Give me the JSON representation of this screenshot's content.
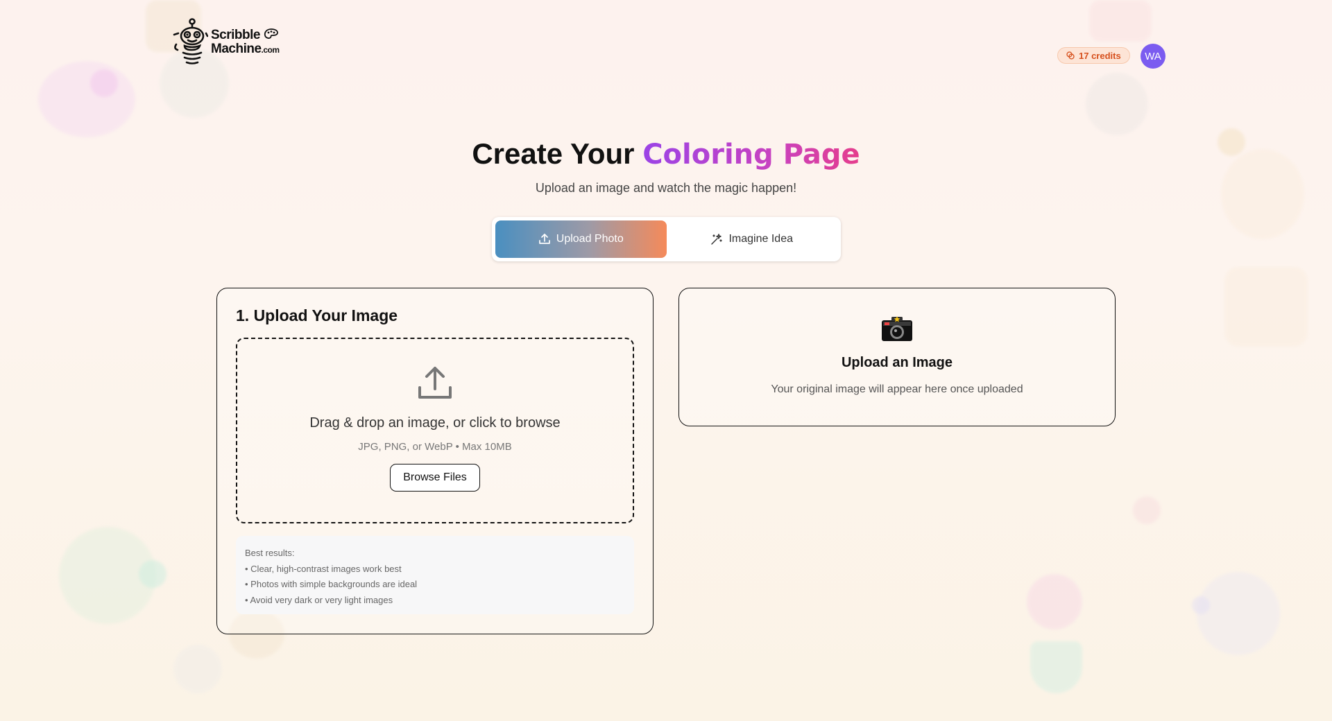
{
  "header": {
    "logo_name": "Scribble",
    "logo_name2": "Machine",
    "logo_domain": ".com",
    "credits": "17 credits",
    "avatar_initials": "WA"
  },
  "hero": {
    "title_prefix": "Create Your",
    "title_accent": "Coloring Page",
    "subtitle": "Upload an image and watch the magic happen!"
  },
  "mode_switch": {
    "tabs": [
      {
        "label": "Upload Photo",
        "icon": "upload-icon",
        "active": true
      },
      {
        "label": "Imagine Idea",
        "icon": "sparkles-icon",
        "active": false
      }
    ]
  },
  "upload_panel": {
    "title": "1. Upload Your Image",
    "drop_text": "Drag & drop an image, or click to browse",
    "drop_hint": "JPG, PNG, or WebP • Max 10MB",
    "browse_label": "Browse Files",
    "tips": [
      "Best results:",
      "• Clear, high-contrast images work best",
      "• Photos with simple backgrounds are ideal",
      "• Avoid very dark or very light images"
    ]
  },
  "preview_panel": {
    "icon": "camera-icon",
    "title": "Upload an Image",
    "subtitle": "Your original image will appear here once uploaded"
  },
  "colors": {
    "accent_gradient": [
      "#4a8fc0",
      "#f58a5a"
    ],
    "title_gradient": [
      "#9b43e6",
      "#e53d8c"
    ],
    "credits": "#d64f1c",
    "avatar": "#7b5cf0"
  }
}
